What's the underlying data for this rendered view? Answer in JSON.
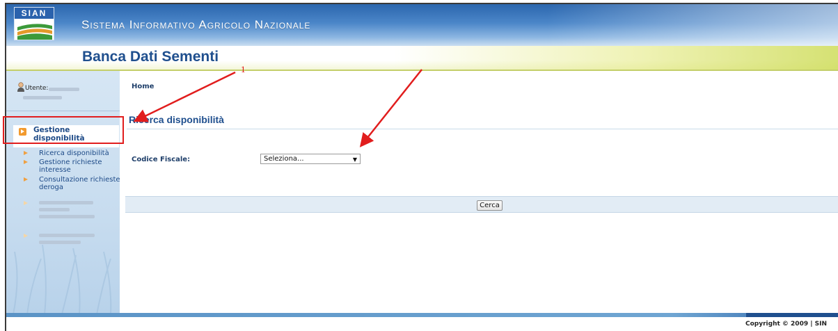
{
  "header": {
    "logo_text": "SIAN",
    "system_title": "Sistema Informativo Agricolo Nazionale",
    "app_title": "Banca Dati Sementi"
  },
  "sidebar": {
    "user_label": "Utente:",
    "active_item": "Gestione disponibilità",
    "items": [
      {
        "label": "Ricerca disponibilità"
      },
      {
        "label": "Gestione richieste interesse"
      },
      {
        "label": "Consultazione richieste deroga"
      }
    ]
  },
  "main": {
    "breadcrumb": "Home",
    "section_title": "Ricerca disponibilità",
    "fields": {
      "codice_fiscale_label": "Codice Fiscale:",
      "codice_fiscale_value": "Seleziona..."
    },
    "search_button": "Cerca"
  },
  "footer": {
    "copyright": "Copyright © 2009 | SIN"
  },
  "annotations": {
    "number": "1"
  },
  "colors": {
    "brand_blue": "#1f4f8e",
    "annotation_red": "#e11d1d",
    "menu_orange": "#f29a2e"
  }
}
